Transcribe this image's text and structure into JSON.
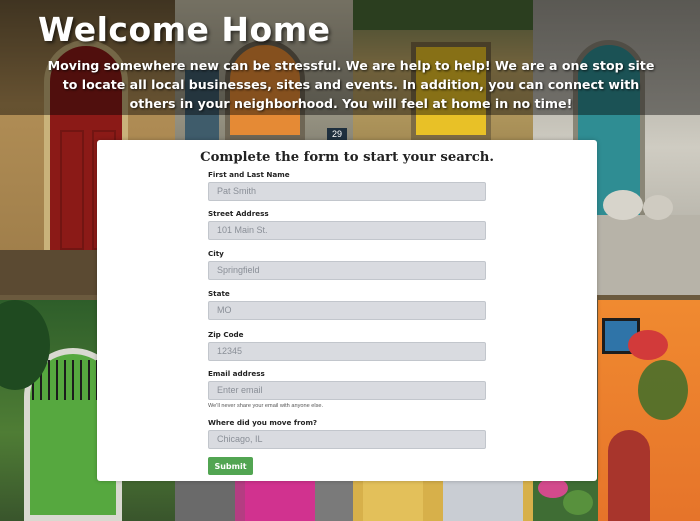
{
  "header": {
    "title": "Welcome Home",
    "intro": "Moving somewhere new can be stressful. We are help to help! We are a one stop site to locate all local businesses, sites and events. In addition, you can connect with others in your neighborhood. You will feel at home in no time!"
  },
  "background": {
    "house_number": "29"
  },
  "form": {
    "heading": "Complete the form to start your search.",
    "fields": [
      {
        "label": "First and Last Name",
        "placeholder": "Pat Smith"
      },
      {
        "label": "Street Address",
        "placeholder": "101 Main St."
      },
      {
        "label": "City",
        "placeholder": "Springfield"
      },
      {
        "label": "State",
        "placeholder": "MO"
      },
      {
        "label": "Zip Code",
        "placeholder": "12345"
      },
      {
        "label": "Email address",
        "placeholder": "Enter email",
        "help": "We'll never share your email with anyone else."
      },
      {
        "label": "Where did you move from?",
        "placeholder": "Chicago, IL"
      }
    ],
    "submit_label": "Submit"
  },
  "colors": {
    "submit": "#52a552",
    "input_bg": "#d9dbe0",
    "card_bg": "#ffffff"
  }
}
